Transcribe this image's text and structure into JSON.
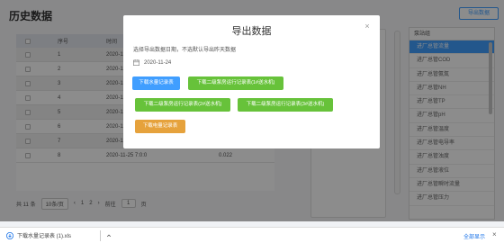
{
  "header": {
    "title": "历史数据",
    "export_label": "导出数据"
  },
  "table": {
    "columns": [
      "序号",
      "时间"
    ],
    "rows": [
      {
        "no": "1",
        "time": "2020-11-25 0:0:0",
        "value": ""
      },
      {
        "no": "2",
        "time": "2020-11-25 0:0:0",
        "value": ""
      },
      {
        "no": "3",
        "time": "2020-11-25 0:0:0",
        "value": ""
      },
      {
        "no": "4",
        "time": "2020-11-25 0:0:0",
        "value": ""
      },
      {
        "no": "5",
        "time": "2020-11-25 0:0:0",
        "value": ""
      },
      {
        "no": "6",
        "time": "2020-11-25 0:0:0",
        "value": ""
      },
      {
        "no": "7",
        "time": "2020-11-25 6:0:0",
        "value": "0.022"
      },
      {
        "no": "8",
        "time": "2020-11-25 7:0:0",
        "value": "0.022"
      }
    ]
  },
  "pagination": {
    "total": "共 11 条",
    "page_size": "10条/页",
    "prev": "‹",
    "page1": "1",
    "page2": "2",
    "next": "›",
    "goto_label": "前往",
    "goto_value": "1",
    "page_unit": "页"
  },
  "right_panel": {
    "header": "泵站组",
    "items": [
      "进厂总管COD",
      "进厂总管氨氮",
      "进厂总管NH",
      "进厂总管TP",
      "进厂总管pH",
      "进厂总管温度",
      "进厂总管电导率",
      "进厂总管浊度",
      "进厂总管液位",
      "进厂总管瞬时流量",
      "进厂总管压力"
    ],
    "active_label": "进厂总管流量"
  },
  "modal": {
    "title": "导出数据",
    "close": "×",
    "tip": "选择导出数据日期，不选默认导出昨天数据",
    "date": "2020-11-24",
    "buttons": {
      "water": "下载水量记录表",
      "pump1": "下载二级泵房运行记录表(1#送水机)",
      "pump2": "下载二级泵房运行记录表(2#送水机)",
      "pump3": "下载二级泵房运行记录表(3#送水机)",
      "power": "下载电量记录表"
    }
  },
  "download_bar": {
    "filename": "下载水量记录表 (1).xls",
    "show_all": "全部显示",
    "close": "×"
  },
  "colors": {
    "primary": "#409eff",
    "success": "#67c23a",
    "warning": "#e6a23c"
  }
}
